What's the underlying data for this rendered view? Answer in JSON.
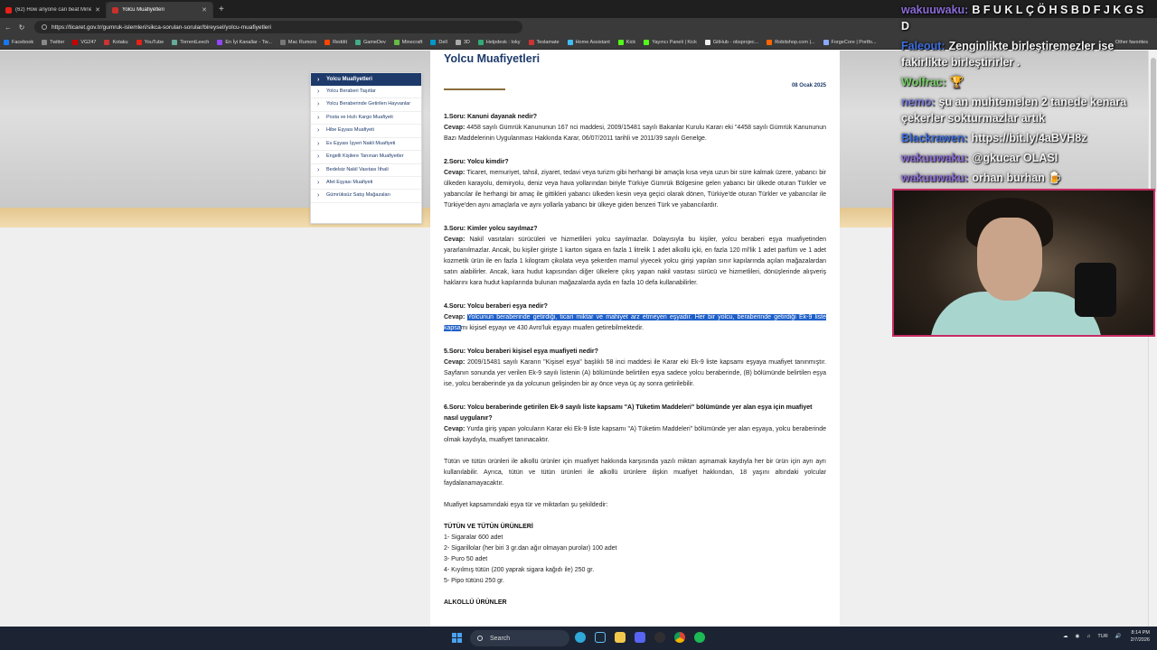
{
  "browser": {
    "tabs": [
      {
        "label": "(62) How anyone can beat Minecr..."
      },
      {
        "label": "Yolcu Muafiyetleri"
      }
    ],
    "url": "https://ticaret.gov.tr/gumruk-islemleri/sikca-sorulan-sorular/bireysel/yolcu-muafiyetleri",
    "bookmarks": [
      "Facebook",
      "Twitter",
      "VG247",
      "Kotaku",
      "YouTube",
      "TorrentLeech",
      "En İyi Kanallar - Tw...",
      "Mac Rumors",
      "Reddit",
      "GameDev",
      "Minecraft",
      "Dell",
      "3D",
      "Helpdesk : Ioky",
      "Teslamate",
      "Home Assistant",
      "Kick",
      "Yayıncı Paneli | Kick",
      "GitHub - obsprojec...",
      "Robitshop.com |...",
      "ForgeCore | Portfo..."
    ],
    "other_bookmarks": "Other favorites"
  },
  "sidebar": {
    "active": "Yolcu Muafiyetleri",
    "items": [
      "Yolcu Beraberi Taşıtlar",
      "Yolcu Beraberinde Getirilen Hayvanlar",
      "Posta ve Hızlı Kargo Muafiyeti",
      "Hibe Eşyası Muafiyeti",
      "Ev Eşyası İşyeri Nakli Muafiyeti",
      "Engelli Kişilere Tanınan Muafiyetler",
      "Bedelsiz Nakil Vasıtası İthali",
      "Afet Eşyası Muafiyeti",
      "Gümrüksüz Satış Mağazaları"
    ]
  },
  "article": {
    "title": "Yolcu Muafiyetleri",
    "date": "08 Ocak 2025",
    "answer_prefix": "Cevap:",
    "qa": [
      {
        "q": "1.Soru: Kanuni dayanak nedir?",
        "a": "4458 sayılı Gümrük Kanununun 167 nci maddesi, 2009/15481 sayılı Bakanlar Kurulu Kararı eki \"4458 sayılı Gümrük Kanununun Bazı Maddelerinin Uygulanması Hakkında Karar, 06/07/2011 tarihli ve 2011/39 sayılı Genelge."
      },
      {
        "q": "2.Soru: Yolcu kimdir?",
        "a": "Ticaret, memuriyet, tahsil, ziyaret, tedavi veya turizm gibi herhangi bir amaçla kısa veya uzun bir süre kalmak üzere, yabancı bir ülkeden karayolu, demiryolu, deniz veya hava yollarından biriyle Türkiye Gümrük Bölgesine gelen yabancı bir ülkede oturan Türkler ve yabancılar ile herhangi bir amaç ile gittikleri yabancı ülkeden kesin veya geçici olarak dönen, Türkiye'de oturan Türkler ve yabancılar ile Türkiye'den aynı amaçlarla ve aynı yollarla yabancı bir ülkeye giden benzeri Türk ve yabancılardır."
      },
      {
        "q": "3.Soru: Kimler yolcu sayılmaz?",
        "a": "Nakil vasıtaları sürücüleri ve hizmetlileri yolcu sayılmazlar. Dolayısıyla bu kişiler, yolcu beraberi eşya muafiyetinden yararlanılmazlar. Ancak, bu kişiler girişte 1 karton sigara en fazla 1 litrelik 1 adet alkollü içki, en fazla 120 ml'lik 1 adet parfüm ve 1 adet kozmetik ürün ile en fazla 1 kilogram çikolata veya şekerden mamul yiyecek yolcu girişi yapılan sınır kapılarında açılan mağazalardan satın alabilirler. Ancak, kara hudut kapısından diğer ülkelere çıkış yapan nakil vasıtası sürücü ve hizmetlileri, dönüşlerinde alışveriş haklarını kara hudut kapılarında bulunan mağazalarda ayda en fazla 10 defa kullanabilirler."
      },
      {
        "q": "4.Soru: Yolcu beraberi eşya nedir?",
        "a_plain_start": "",
        "a_selected": "Yolcunun beraberinde getirdiği, ticari miktar ve mahiyet arz etmeyen eşyadır. Her bir yolcu, beraberinde getirdiği Ek-9 liste kapsa",
        "a_rest": "mı kişisel eşyayı ve 430 Avro'luk eşyayı muafen getirebilmektedir."
      },
      {
        "q": "5.Soru: Yolcu beraberi kişisel eşya muafiyeti nedir?",
        "a": "2009/15481 sayılı Kararın \"Kişisel eşya\" başlıklı 58 inci maddesi ile Karar eki Ek-9 liste kapsamı eşyaya muafiyet tanınmıştır. Sayfanın sonunda yer verilen Ek-9 sayılı listenin (A) bölümünde belirtilen eşya sadece yolcu beraberinde, (B) bölümünde belirtilen eşya ise, yolcu beraberinde ya da yolcunun gelişinden bir ay önce veya üç ay sonra getirilebilir."
      },
      {
        "q": "6.Soru: Yolcu beraberinde getirilen Ek-9 sayılı liste kapsamı \"A) Tüketim Maddeleri\" bölümünde yer alan eşya için muafiyet nasıl uygulanır?",
        "a": "Yurda giriş yapan yolcuların Karar eki Ek-9 liste kapsamı \"A) Tüketim Maddeleri\" bölümünde yer alan eşyaya, yolcu beraberinde olmak kaydıyla, muafiyet tanınacaktır."
      }
    ],
    "para1": "Tütün ve tütün ürünleri ile alkollü ürünler için muafiyet hakkında karşısında yazılı miktarı aşmamak kaydıyla her bir ürün için ayrı ayrı kullanılabilir. Ayrıca, tütün ve tütün ürünleri ile alkollü ürünlere ilişkin muafiyet hakkından, 18 yaşını altındaki yolcular faydalanamayacaktır.",
    "para2": "Muafiyet kapsamındaki eşya tür ve miktarları şu şekildedir:",
    "tobacco_head": "TÜTÜN VE TÜTÜN ÜRÜNLERİ",
    "tobacco_items": [
      "1- Sigaralar 600 adet",
      "2- Sigarillolar (her biri 3 gr.dan ağır olmayan purolar) 100 adet",
      "3- Puro 50 adet",
      "4- Kıyılmış tütün (200 yaprak sigara kağıdı ile) 250 gr.",
      "5- Pipo tütünü 250 gr."
    ],
    "alcohol_head": "ALKOLLÜ ÜRÜNLER"
  },
  "stream_chat": [
    {
      "user": "wakuuwaku:",
      "msg": "B F U K L Ç Ö H S B D F J K G S D",
      "color": "#8a6bd6"
    },
    {
      "user": "Faleout:",
      "msg": "Zenginlikte birleştiremezler ise fakirlikte birleştirirler .",
      "color": "#3f6fe0"
    },
    {
      "user": "Wolfrac:",
      "msg": "🏆",
      "color": "#7ad06a"
    },
    {
      "user": "nemo:",
      "msg": "şu an muhtemelen 2 tanede kenara çekerler sokturmazlar artık",
      "color": "#7b7bd8"
    },
    {
      "user": "Blackrawen:",
      "msg": "https://bit.ly/4aBVH8z",
      "color": "#3f6fe0"
    },
    {
      "user": "wakuuwaku:",
      "msg": "@gkucar OLASI",
      "color": "#8a6bd6"
    },
    {
      "user": "wakuuwaku:",
      "msg": "orhan burhan 🍺",
      "color": "#8a6bd6"
    }
  ],
  "taskbar": {
    "search_placeholder": "Search",
    "lang": "TUR",
    "time": "8:14 PM",
    "date": "2/7/2026"
  },
  "colors": {
    "brand_navy": "#1d3a6b",
    "selection": "#1e5fc8",
    "webcam_border": "#c72c64",
    "banner_gold": "#e3c690"
  }
}
